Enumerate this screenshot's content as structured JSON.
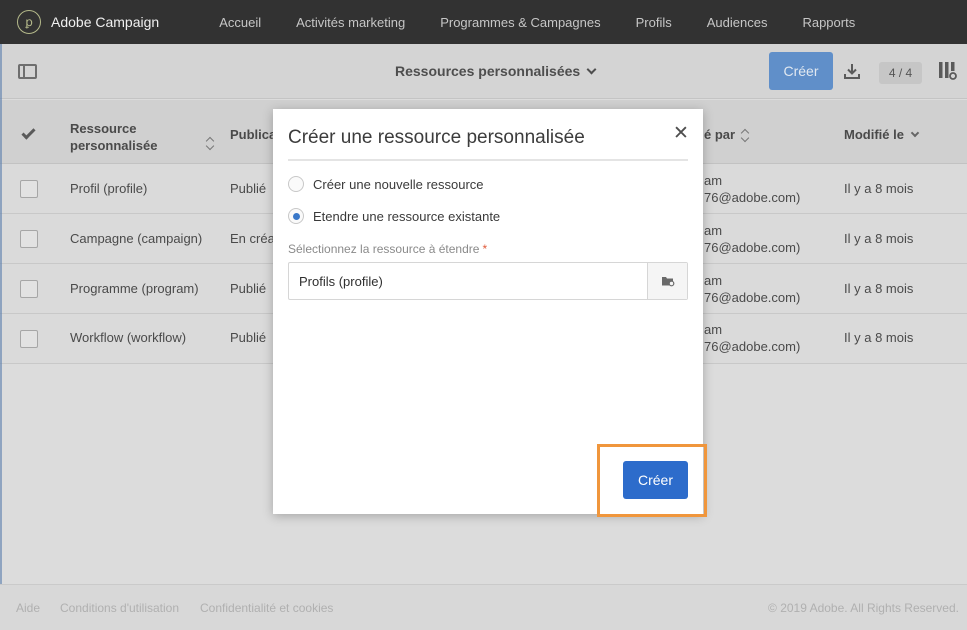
{
  "app": {
    "name": "Adobe Campaign",
    "logo_glyph": "ꝑ"
  },
  "nav": [
    {
      "label": "Accueil"
    },
    {
      "label": "Activités marketing"
    },
    {
      "label": "Programmes & Campagnes"
    },
    {
      "label": "Profils"
    },
    {
      "label": "Audiences"
    },
    {
      "label": "Rapports"
    }
  ],
  "toolbar": {
    "view_title": "Ressources personnalisées",
    "create_label": "Créer",
    "counter": "4 / 4"
  },
  "table": {
    "headers": {
      "resource": "Ressource personnalisée",
      "publication": "Publica",
      "modified_by": "é par",
      "modified_on": "Modifié le"
    },
    "rows": [
      {
        "resource": "Profil (profile)",
        "publication": "Publié",
        "by_line1": "am",
        "by_line2": "76@adobe.com)",
        "modified": "Il y a 8 mois"
      },
      {
        "resource": "Campagne (campaign)",
        "publication": "En créat",
        "by_line1": "am",
        "by_line2": "76@adobe.com)",
        "modified": "Il y a 8 mois"
      },
      {
        "resource": "Programme (program)",
        "publication": "Publié",
        "by_line1": "am",
        "by_line2": "76@adobe.com)",
        "modified": "Il y a 8 mois"
      },
      {
        "resource": "Workflow (workflow)",
        "publication": "Publié",
        "by_line1": "am",
        "by_line2": "76@adobe.com)",
        "modified": "Il y a 8 mois"
      }
    ]
  },
  "footer": {
    "help": "Aide",
    "terms": "Conditions d'utilisation",
    "privacy": "Confidentialité et cookies",
    "copyright": "© 2019 Adobe. All Rights Reserved."
  },
  "dialog": {
    "title": "Créer une ressource personnalisée",
    "close_glyph": "✕",
    "option_new": "Créer une nouvelle ressource",
    "option_extend": "Etendre une ressource existante",
    "selected_option": "extend",
    "field_label": "Sélectionnez la ressource à étendre",
    "required_mark": "*",
    "field_value": "Profils (profile)",
    "create_label": "Créer"
  },
  "colors": {
    "primary_button": "#2d6ccb",
    "highlight": "#f0963c",
    "nav_bg": "#323232"
  }
}
